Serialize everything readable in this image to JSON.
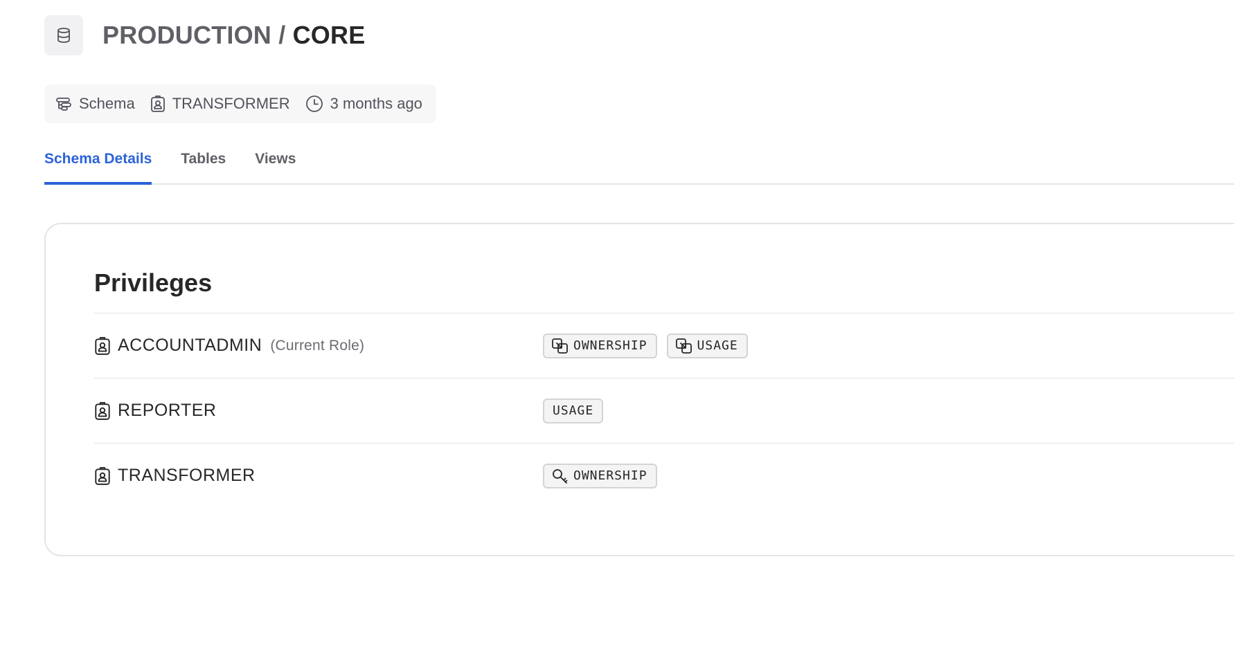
{
  "header": {
    "icon": "database-icon",
    "breadcrumb_parent": "PRODUCTION",
    "breadcrumb_separator": " / ",
    "breadcrumb_current": "CORE"
  },
  "meta": {
    "type": {
      "icon": "schema-icon",
      "label": "Schema"
    },
    "owner": {
      "icon": "role-badge-icon",
      "label": "TRANSFORMER"
    },
    "updated": {
      "icon": "clock-icon",
      "label": "3 months ago"
    }
  },
  "tabs": [
    {
      "label": "Schema Details",
      "active": true
    },
    {
      "label": "Tables",
      "active": false
    },
    {
      "label": "Views",
      "active": false
    }
  ],
  "privileges": {
    "title": "Privileges",
    "rows": [
      {
        "role": "ACCOUNTADMIN",
        "note": "(Current Role)",
        "grants": [
          {
            "icon": "inherited-grant-icon",
            "label": "OWNERSHIP"
          },
          {
            "icon": "inherited-grant-icon",
            "label": "USAGE"
          }
        ]
      },
      {
        "role": "REPORTER",
        "note": "",
        "grants": [
          {
            "icon": "",
            "label": "USAGE"
          }
        ]
      },
      {
        "role": "TRANSFORMER",
        "note": "",
        "grants": [
          {
            "icon": "key-icon",
            "label": "OWNERSHIP"
          }
        ]
      }
    ]
  },
  "colors": {
    "accent": "#2b63d9",
    "text": "#27272a",
    "muted": "#5f5f66",
    "border": "#e4e4e7"
  }
}
